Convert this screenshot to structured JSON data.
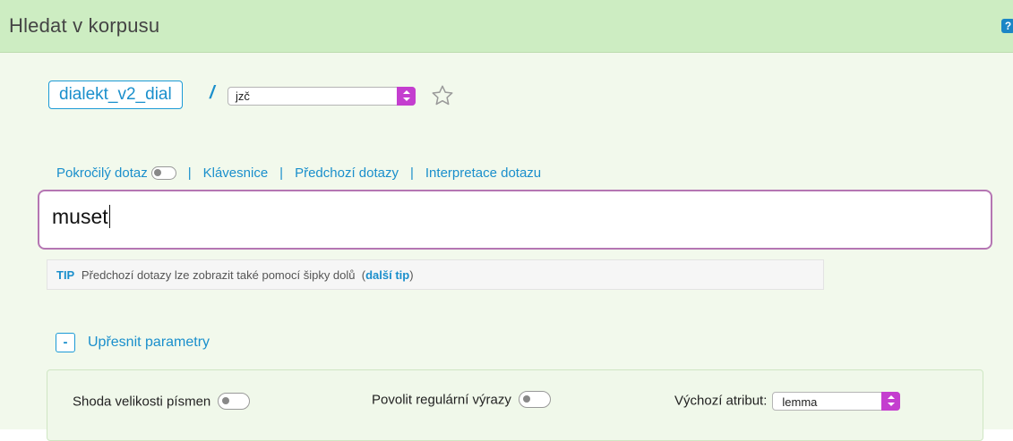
{
  "header": {
    "title": "Hledat v korpusu",
    "help_icon": "question-icon"
  },
  "corpus": {
    "name": "dialekt_v2_dial",
    "separator": "/",
    "subcorpus_selected": "jzč",
    "favorite_icon": "star-outline-icon"
  },
  "query_links": {
    "advanced_query": "Pokročilý dotaz",
    "keyboard": "Klávesnice",
    "previous_queries": "Předchozí dotazy",
    "query_interpretation": "Interpretace dotazu"
  },
  "query": {
    "value": "muset"
  },
  "tip": {
    "label": "TIP",
    "text": "Předchozí dotazy lze zobrazit také pomocí šipky dolů",
    "link_prefix": "(",
    "link": "další tip",
    "link_suffix": ")"
  },
  "refine": {
    "toggle_label": "-",
    "label": "Upřesnit parametry"
  },
  "options": {
    "case_sensitive": "Shoda velikosti písmen",
    "allow_regex": "Povolit regulární výrazy",
    "default_attr_label": "Výchozí atribut:",
    "default_attr_value": "lemma"
  },
  "colors": {
    "header_bg": "#cdedc2",
    "panel_bg": "#f2f9ec",
    "link": "#1a8fcc",
    "select_accent": "#c43ecf",
    "query_border": "#b576b3"
  }
}
